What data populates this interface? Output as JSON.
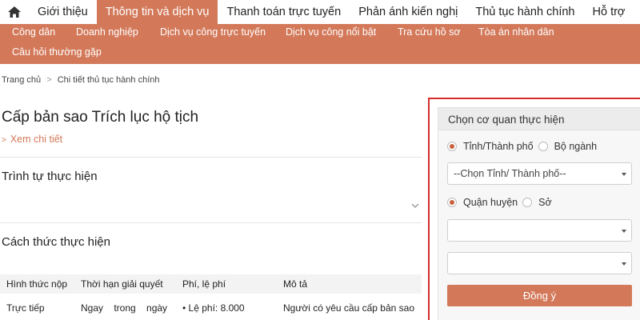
{
  "topnav": {
    "items": [
      "Giới thiệu",
      "Thông tin và dịch vụ",
      "Thanh toán trực tuyến",
      "Phản ánh kiến nghị",
      "Thủ tục hành chính",
      "Hỗ trợ"
    ],
    "active_index": 1
  },
  "subnav": {
    "items": [
      "Công dân",
      "Doanh nghiệp",
      "Dịch vụ công trực tuyến",
      "Dịch vụ công nổi bật",
      "Tra cứu hồ sơ",
      "Tòa án nhân dân",
      "Câu hỏi thường gặp"
    ]
  },
  "breadcrumb": {
    "home": "Trang chủ",
    "sep": ">",
    "current": "Chi tiết thủ tục hành chính"
  },
  "main": {
    "title": "Cấp bản sao Trích lục hộ tịch",
    "more_prefix": ">",
    "more_label": "Xem chi tiết",
    "section1": "Trình tự thực hiện",
    "section2": "Cách thức thực hiện",
    "table": {
      "headers": [
        "Hình thức nộp",
        "Thời hạn giải quyết",
        "Phí, lệ phí",
        "Mô tả"
      ],
      "row1": {
        "c1": "Trực tiếp",
        "c2": "Ngay    trong    ngày",
        "c3": "•  Lệ phí: 8.000",
        "c4": "Người có yêu cầu cấp bản sao"
      }
    }
  },
  "panel": {
    "title": "Chọn cơ quan thực hiện",
    "radio1": {
      "a": "Tỉnh/Thành phố",
      "b": "Bộ ngành"
    },
    "select1": "--Chọn Tỉnh/ Thành phố--",
    "radio2": {
      "a": "Quận huyện",
      "b": "Sở"
    },
    "select2": "",
    "select3": "",
    "submit": "Đồng ý"
  },
  "colors": {
    "accent": "#d3795a",
    "highlight_border": "#d62d2d"
  }
}
